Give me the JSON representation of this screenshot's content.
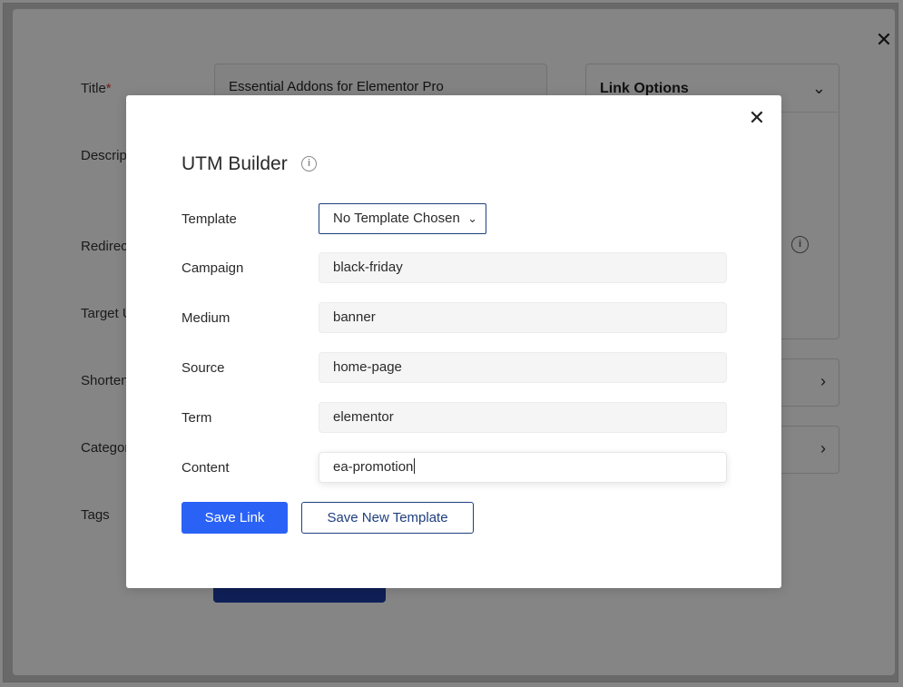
{
  "background": {
    "close_icon": "close-icon",
    "labels": {
      "title": "Title",
      "title_required": "*",
      "description": "Descripti",
      "redirect": "Redirect",
      "target_url": "Target U",
      "shortened": "Shortene",
      "category": "Category",
      "tags": "Tags"
    },
    "title_value": "Essential Addons for Elementor Pro",
    "link_options": "Link Options"
  },
  "modal": {
    "title": "UTM Builder",
    "info_icon": "info-icon",
    "close_icon": "close-icon",
    "template": {
      "label": "Template",
      "selected": "No Template Chosen"
    },
    "fields": {
      "campaign_label": "Campaign",
      "campaign_value": "black-friday",
      "medium_label": "Medium",
      "medium_value": "banner",
      "source_label": "Source",
      "source_value": "home-page",
      "term_label": "Term",
      "term_value": "elementor",
      "content_label": "Content",
      "content_value": "ea-promotion"
    },
    "buttons": {
      "save_link": "Save Link",
      "save_template": "Save New Template"
    }
  },
  "colors": {
    "primary": "#2b62f6",
    "outline": "#1f3f7f",
    "overlay": "rgba(0,0,0,0.48)"
  }
}
